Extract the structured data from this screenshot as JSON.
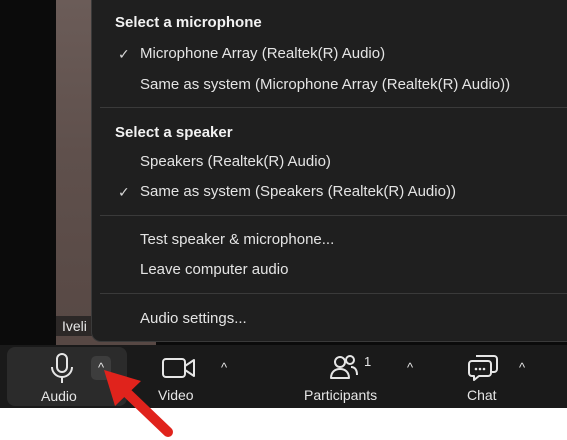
{
  "participant": {
    "name": "Iveli"
  },
  "menu": {
    "microphone_heading": "Select a microphone",
    "microphones": [
      {
        "label": "Microphone Array (Realtek(R) Audio)",
        "checked": true
      },
      {
        "label": "Same as system (Microphone Array (Realtek(R) Audio))",
        "checked": false
      }
    ],
    "speaker_heading": "Select a speaker",
    "speakers": [
      {
        "label": "Speakers (Realtek(R) Audio)",
        "checked": false
      },
      {
        "label": "Same as system (Speakers (Realtek(R) Audio))",
        "checked": true
      }
    ],
    "test_label": "Test speaker & microphone...",
    "leave_label": "Leave computer audio",
    "settings_label": "Audio settings...",
    "check_glyph": "✓"
  },
  "toolbar": {
    "audio_label": "Audio",
    "video_label": "Video",
    "participants_label": "Participants",
    "participants_count": "1",
    "chat_label": "Chat",
    "caret_glyph": "^"
  },
  "colors": {
    "annotation_arrow": "#e0231c",
    "toolbar_bg": "#1a1a1a",
    "menu_bg": "#1f1f1f"
  }
}
